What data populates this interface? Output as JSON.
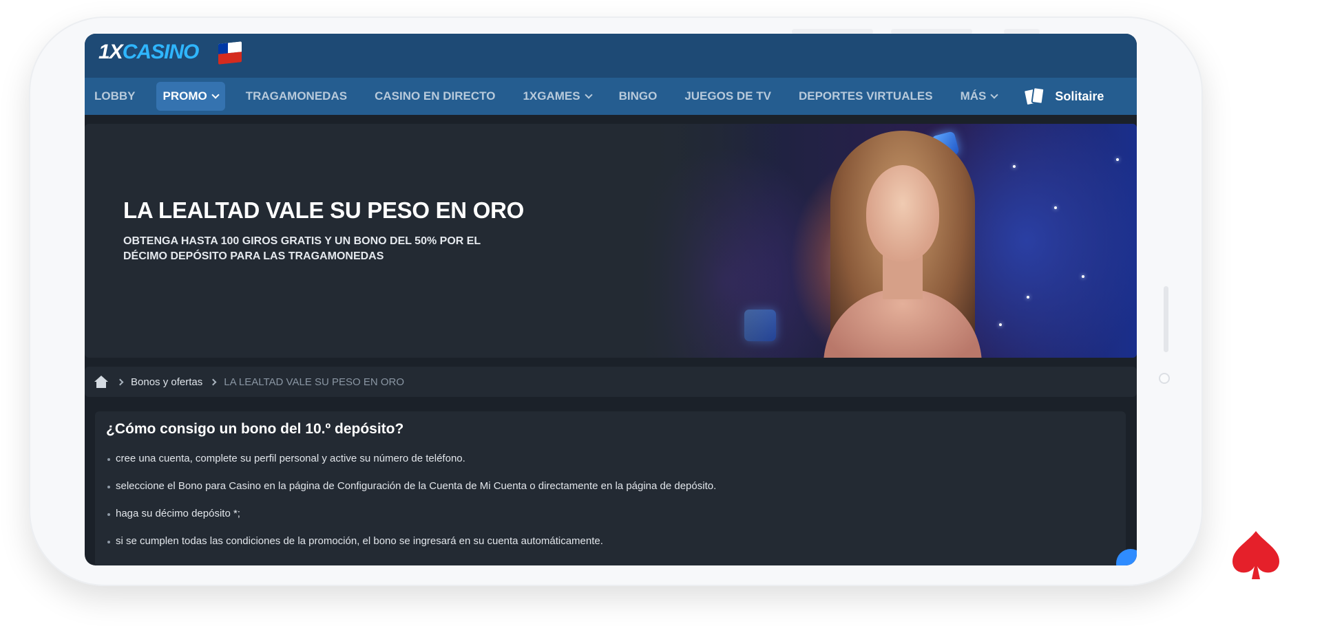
{
  "header": {
    "logo_part1": "1X",
    "logo_part2": "CASINO",
    "flag": "chile-flag-icon"
  },
  "nav": {
    "items": [
      {
        "label": "LOBBY",
        "dropdown": false,
        "active": false
      },
      {
        "label": "PROMO",
        "dropdown": true,
        "active": true
      },
      {
        "label": "TRAGAMONEDAS",
        "dropdown": false,
        "active": false
      },
      {
        "label": "CASINO EN DIRECTO",
        "dropdown": false,
        "active": false
      },
      {
        "label": "1XGAMES",
        "dropdown": true,
        "active": false
      },
      {
        "label": "BINGO",
        "dropdown": false,
        "active": false
      },
      {
        "label": "JUEGOS DE TV",
        "dropdown": false,
        "active": false
      },
      {
        "label": "DEPORTES VIRTUALES",
        "dropdown": false,
        "active": false
      },
      {
        "label": "MÁS",
        "dropdown": true,
        "active": false
      }
    ],
    "solitaire_label": "Solitaire"
  },
  "hero": {
    "title": "LA LEALTAD VALE SU PESO EN ORO",
    "subtitle": "OBTENGA HASTA 100 GIROS GRATIS Y UN BONO DEL 50% POR EL DÉCIMO DEPÓSITO PARA LAS TRAGAMONEDAS"
  },
  "breadcrumb": {
    "home_icon": "home-icon",
    "link": "Bonos y ofertas",
    "current": "LA LEALTAD VALE SU PESO EN ORO"
  },
  "content": {
    "heading": "¿Cómo consigo un bono del 10.º depósito?",
    "steps": [
      "cree una cuenta, complete su perfil personal y active su número de teléfono.",
      "seleccione el Bono para Casino en la página de Configuración de la Cuenta de Mi Cuenta o directamente en la página de depósito.",
      "haga su décimo depósito *;",
      "si se cumplen todas las condiciones de la promoción, el bono se ingresará en su cuenta automáticamente."
    ]
  },
  "colors": {
    "header_bg": "#1e4a75",
    "nav_bg": "#255d90",
    "nav_active": "#3573b0",
    "page_bg": "#1b2129",
    "panel_bg": "#232a33",
    "brand_red": "#e5202a"
  }
}
